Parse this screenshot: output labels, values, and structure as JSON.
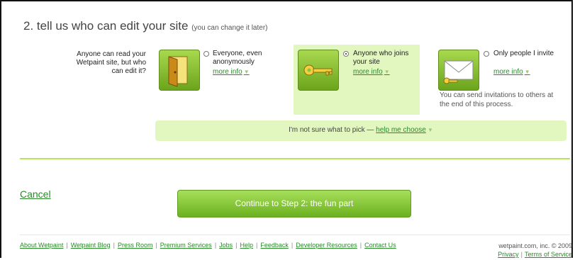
{
  "header": {
    "title": "2. tell us who can edit your site",
    "subtitle": "(you can change it later)"
  },
  "question": "Anyone can read your Wetpaint site, but who can edit it?",
  "options": [
    {
      "label": "Everyone, even anonymously",
      "more": "more info",
      "icon": "door-icon",
      "selected": false
    },
    {
      "label": "Anyone who joins your site",
      "more": "more info",
      "icon": "key-icon",
      "selected": true
    },
    {
      "label": "Only people I invite",
      "more": "more info",
      "icon": "envelope-icon",
      "selected": false
    }
  ],
  "invite_note": "You can send invitations to others at the end of this process.",
  "help": {
    "text": "I'm not sure what to pick —",
    "link": "help me choose"
  },
  "actions": {
    "cancel": "Cancel",
    "continue": "Continue to Step 2: the fun part"
  },
  "footer": {
    "links": [
      "About Wetpaint",
      "Wetpaint Blog",
      "Press Room",
      "Premium Services",
      "Jobs",
      "Help",
      "Feedback",
      "Developer Resources",
      "Contact Us"
    ],
    "copyright": "wetpaint.com, inc. © 2009",
    "privacy": "Privacy",
    "terms": "Terms of Service"
  },
  "colors": {
    "accent": "#2a8a2a",
    "selected_bg": "#e2f7c0",
    "button_green": "#7cc02d"
  }
}
